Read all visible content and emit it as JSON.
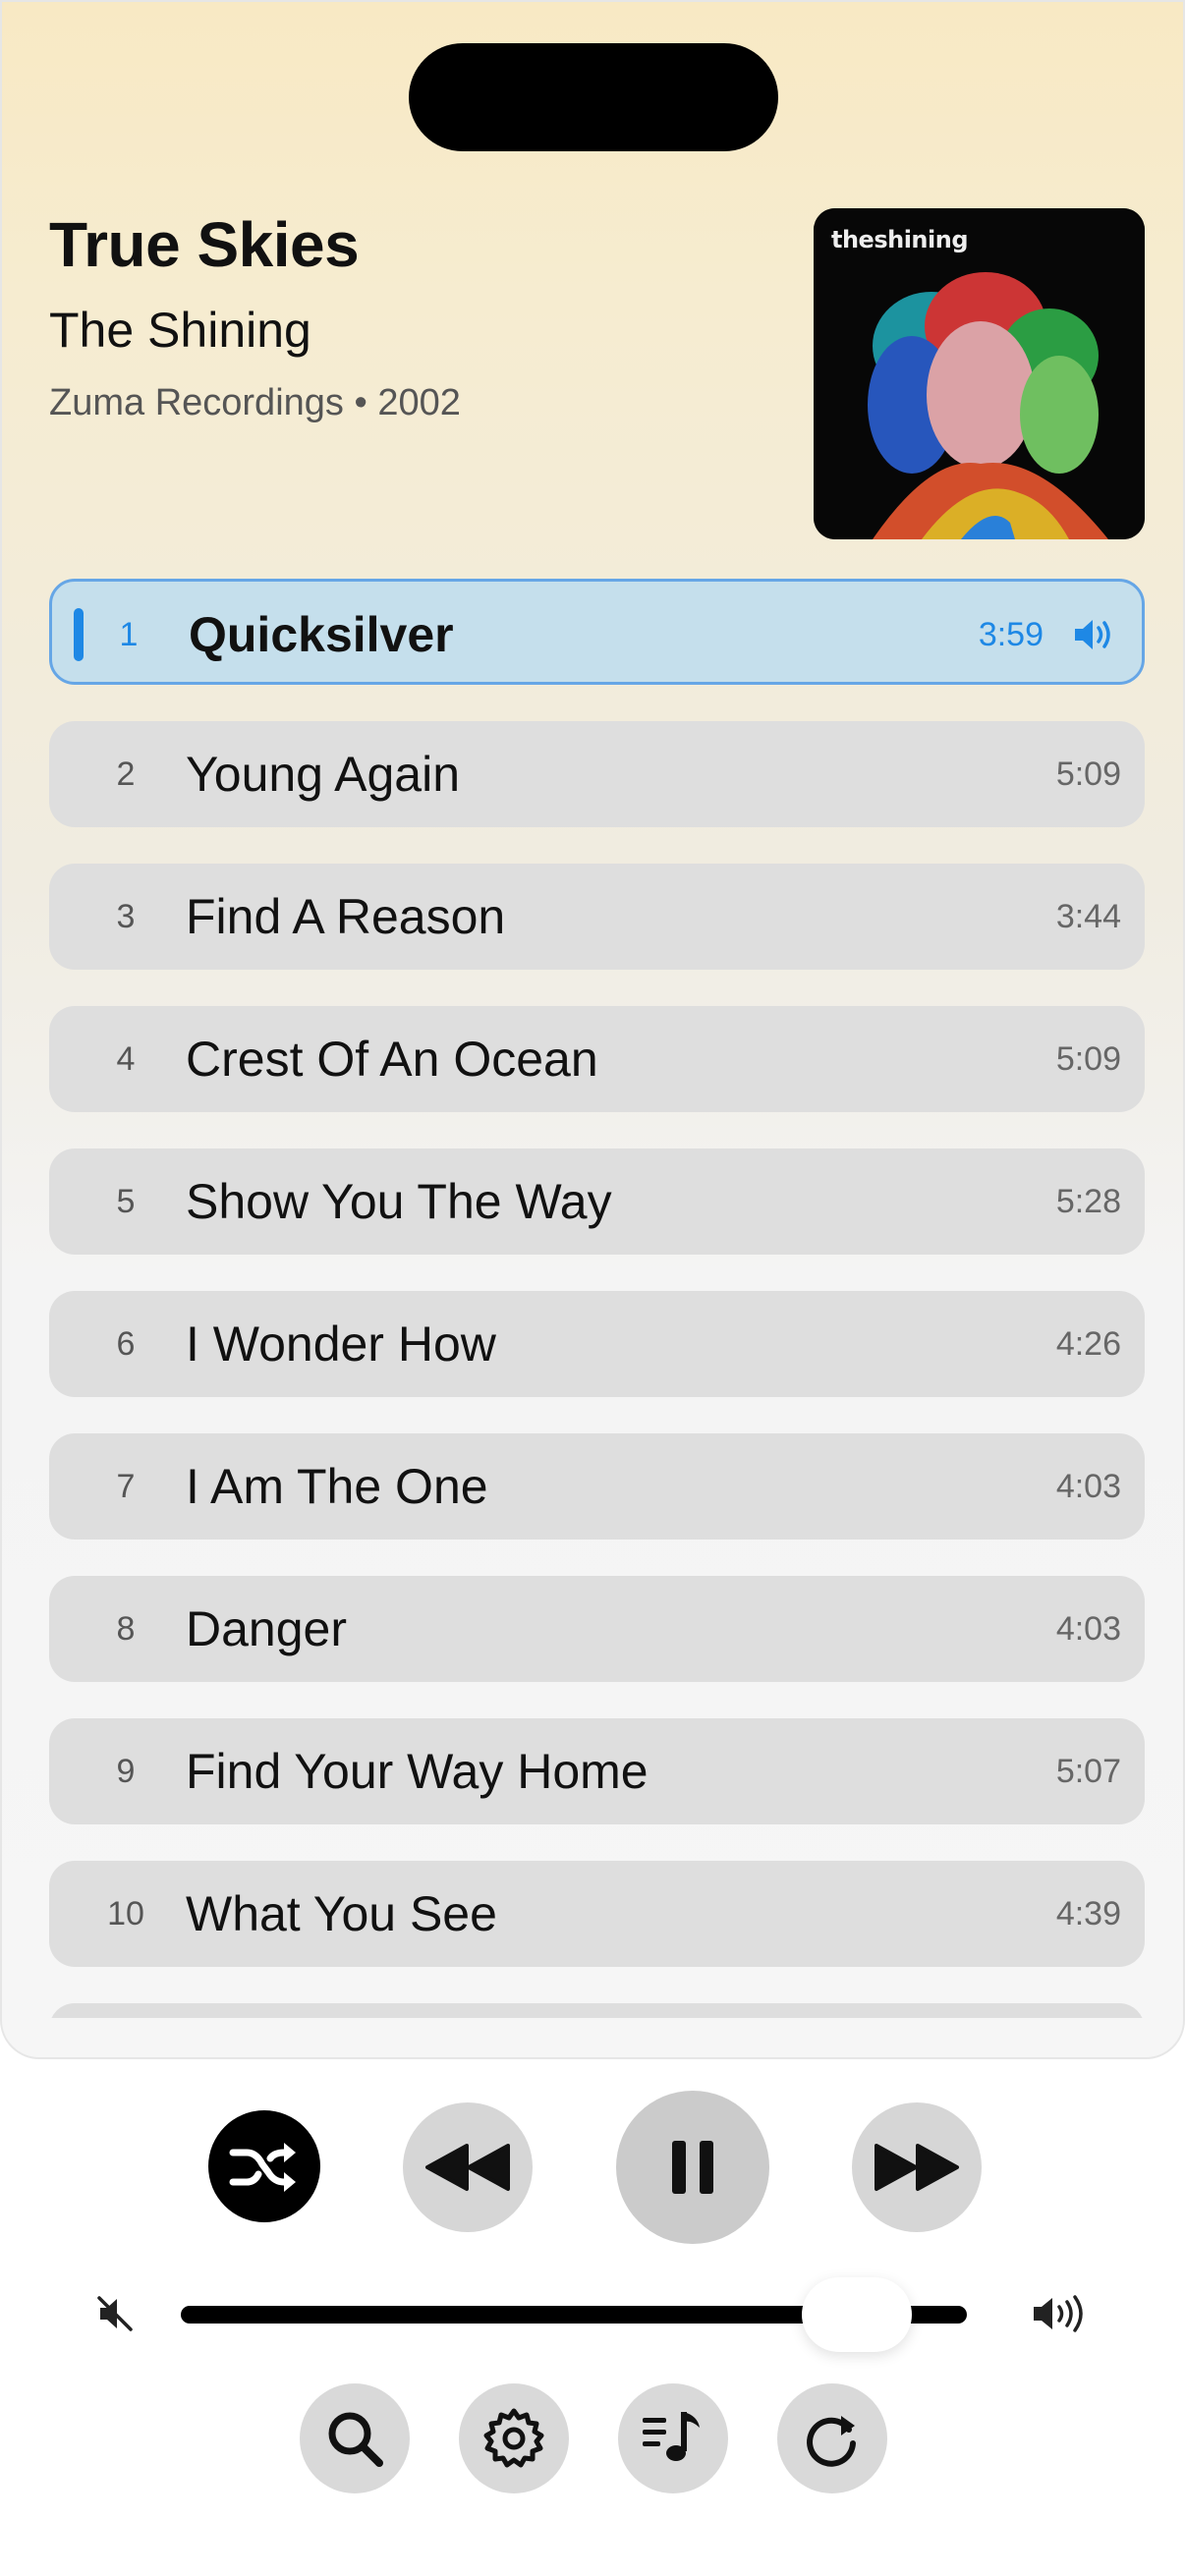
{
  "album": {
    "title": "True Skies",
    "artist": "The Shining",
    "label_year": "Zuma Recordings • 2002",
    "cover_text": "theshining"
  },
  "tracks": [
    {
      "num": "1",
      "name": "Quicksilver",
      "duration": "3:59",
      "playing": true
    },
    {
      "num": "2",
      "name": "Young Again",
      "duration": "5:09"
    },
    {
      "num": "3",
      "name": "Find A Reason",
      "duration": "3:44"
    },
    {
      "num": "4",
      "name": "Crest Of An Ocean",
      "duration": "5:09"
    },
    {
      "num": "5",
      "name": "Show You The Way",
      "duration": "5:28"
    },
    {
      "num": "6",
      "name": "I Wonder How",
      "duration": "4:26"
    },
    {
      "num": "7",
      "name": "I Am The One",
      "duration": "4:03"
    },
    {
      "num": "8",
      "name": "Danger",
      "duration": "4:03"
    },
    {
      "num": "9",
      "name": "Find Your Way Home",
      "duration": "5:07"
    },
    {
      "num": "10",
      "name": "What You See",
      "duration": "4:39"
    }
  ],
  "volume": {
    "level_fraction": 0.86
  },
  "icons": {
    "shuffle": "shuffle-icon",
    "previous": "rewind-icon",
    "play_pause": "pause-icon",
    "next": "fast-forward-icon",
    "mute": "mute-icon",
    "volume": "volume-icon",
    "search": "search-icon",
    "settings": "gear-icon",
    "lyrics": "music-list-icon",
    "repeat": "repeat-icon"
  },
  "colors": {
    "accent": "#1e88e5",
    "active_row": "#c5dfec",
    "row": "#dedede"
  }
}
